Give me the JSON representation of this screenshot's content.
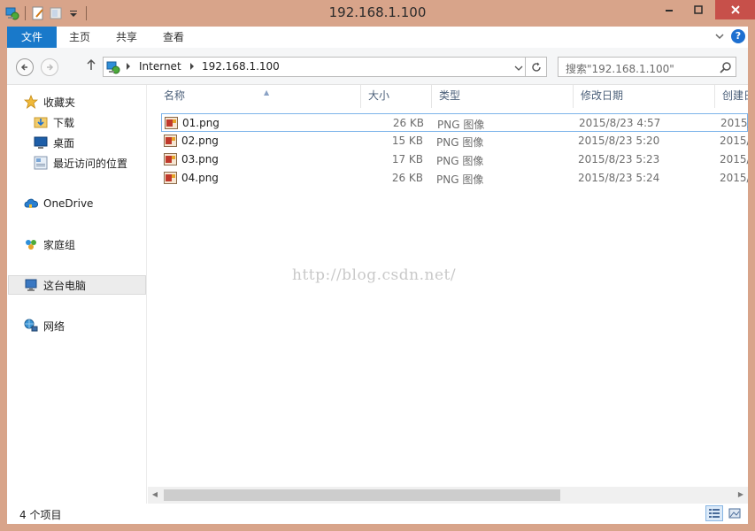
{
  "window": {
    "title": "192.168.1.100"
  },
  "ribbon": {
    "tabs": [
      {
        "label": "文件"
      },
      {
        "label": "主页"
      },
      {
        "label": "共享"
      },
      {
        "label": "查看"
      }
    ]
  },
  "address": {
    "crumbs": [
      "Internet",
      "192.168.1.100"
    ],
    "search_placeholder": "搜索\"192.168.1.100\""
  },
  "sidebar": {
    "items": [
      {
        "label": "收藏夹",
        "icon": "star-icon"
      },
      {
        "label": "下载",
        "icon": "download-folder-icon"
      },
      {
        "label": "桌面",
        "icon": "desktop-icon"
      },
      {
        "label": "最近访问的位置",
        "icon": "recent-places-icon"
      },
      {
        "label": "OneDrive",
        "icon": "cloud-icon"
      },
      {
        "label": "家庭组",
        "icon": "homegroup-icon"
      },
      {
        "label": "这台电脑",
        "icon": "computer-icon"
      },
      {
        "label": "网络",
        "icon": "network-icon"
      }
    ]
  },
  "columns": {
    "name": "名称",
    "size": "大小",
    "type": "类型",
    "modified": "修改日期",
    "created": "创建日"
  },
  "files": [
    {
      "name": "01.png",
      "size": "26 KB",
      "type": "PNG 图像",
      "modified": "2015/8/23 4:57",
      "created": "2015/"
    },
    {
      "name": "02.png",
      "size": "15 KB",
      "type": "PNG 图像",
      "modified": "2015/8/23 5:20",
      "created": "2015/"
    },
    {
      "name": "03.png",
      "size": "17 KB",
      "type": "PNG 图像",
      "modified": "2015/8/23 5:23",
      "created": "2015/"
    },
    {
      "name": "04.png",
      "size": "26 KB",
      "type": "PNG 图像",
      "modified": "2015/8/23 5:24",
      "created": "2015/"
    }
  ],
  "watermark": "http://blog.csdn.net/",
  "status": {
    "count": "4 个项目"
  },
  "colors": {
    "frame": "#d8a48a",
    "file_tab": "#1979ca",
    "close": "#c7504a",
    "header_text": "#4c607a"
  }
}
